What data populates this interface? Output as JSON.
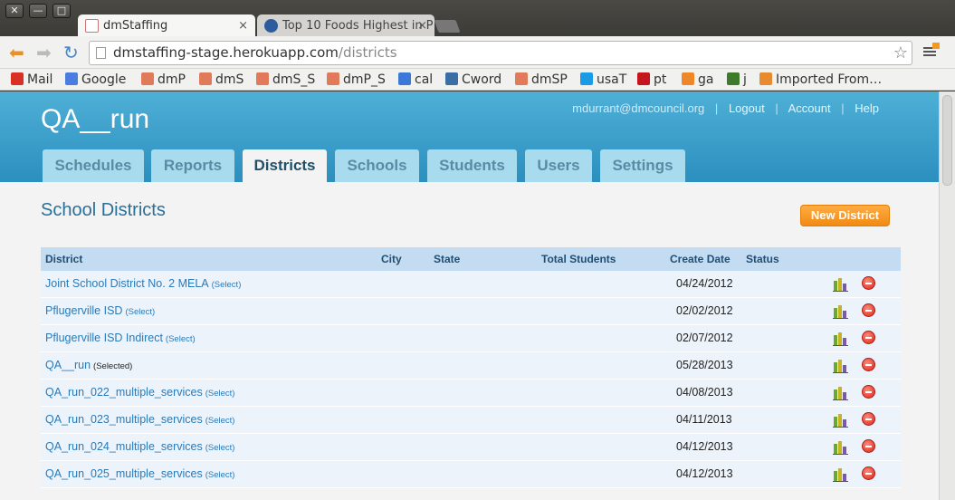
{
  "browser": {
    "tabs": [
      {
        "title": "dmStaffing",
        "active": true
      },
      {
        "title": "Top 10 Foods Highest in P",
        "active": false
      }
    ],
    "tab_close": "×",
    "url_host": "dmstaffing-stage.herokuapp.com",
    "url_path": "/districts",
    "bookmarks": [
      {
        "label": "Mail",
        "icon": "gmail-icon",
        "color": "#d93025"
      },
      {
        "label": "Google",
        "icon": "google-icon",
        "color": "#4a7de0"
      },
      {
        "label": "dmP",
        "icon": "calendar-page-icon",
        "color": "#e07a5a"
      },
      {
        "label": "dmS",
        "icon": "calendar-page-icon",
        "color": "#e07a5a"
      },
      {
        "label": "dmS_S",
        "icon": "calendar-page-icon",
        "color": "#e07a5a"
      },
      {
        "label": "dmP_S",
        "icon": "calendar-page-icon",
        "color": "#e07a5a"
      },
      {
        "label": "cal",
        "icon": "calendar-icon",
        "color": "#3b78d8"
      },
      {
        "label": "Cword",
        "icon": "book-icon",
        "color": "#3a6ea5"
      },
      {
        "label": "dmSP",
        "icon": "calendar-page-icon",
        "color": "#e07a5a"
      },
      {
        "label": "usaT",
        "icon": "circle-icon",
        "color": "#1a9be6"
      },
      {
        "label": "pt",
        "icon": "record-icon",
        "color": "#c4161c"
      },
      {
        "label": "ga",
        "icon": "analytics-icon",
        "color": "#f0862a"
      },
      {
        "label": "j",
        "icon": "puzzle-icon",
        "color": "#3e7a2b"
      },
      {
        "label": "Imported From…",
        "icon": "folder-icon",
        "color": "#e88a2e"
      }
    ]
  },
  "app": {
    "title": "QA__run",
    "user_links": {
      "email": "mdurrant@dmcouncil.org",
      "logout": "Logout",
      "account": "Account",
      "help": "Help",
      "separator": "|"
    },
    "nav_tabs": [
      "Schedules",
      "Reports",
      "Districts",
      "Schools",
      "Students",
      "Users",
      "Settings"
    ],
    "active_tab": "Districts"
  },
  "main": {
    "title": "School Districts",
    "new_button": "New District",
    "columns": [
      "District",
      "City",
      "State",
      "Total Students",
      "Create Date",
      "Status"
    ],
    "rows": [
      {
        "name": "Joint School District No. 2 MELA",
        "select": "(Select)",
        "date": "04/24/2012"
      },
      {
        "name": "Pflugerville ISD",
        "select": "(Select)",
        "date": "02/02/2012"
      },
      {
        "name": "Pflugerville ISD Indirect",
        "select": "(Select)",
        "date": "02/07/2012"
      },
      {
        "name": "QA__run",
        "select": "(Selected)",
        "date": "05/28/2013"
      },
      {
        "name": "QA_run_022_multiple_services",
        "select": "(Select)",
        "date": "04/08/2013"
      },
      {
        "name": "QA_run_023_multiple_services",
        "select": "(Select)",
        "date": "04/11/2013"
      },
      {
        "name": "QA_run_024_multiple_services",
        "select": "(Select)",
        "date": "04/12/2013"
      },
      {
        "name": "QA_run_025_multiple_services",
        "select": "(Select)",
        "date": "04/12/2013"
      }
    ]
  },
  "colors": {
    "header_top": "#4fb0d6",
    "header_bottom": "#2b8fbf",
    "accent_orange": "#f28a12",
    "link_blue": "#2a7ab8",
    "table_header": "#c3dcf1"
  }
}
